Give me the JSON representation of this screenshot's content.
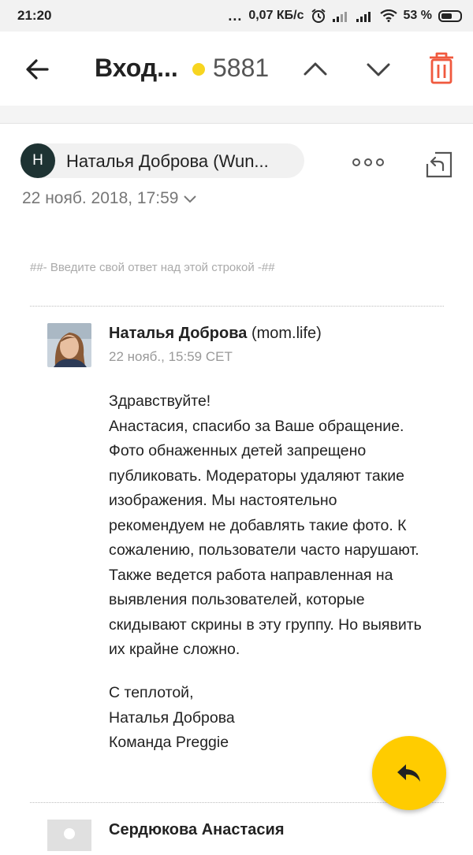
{
  "status_bar": {
    "time": "21:20",
    "dots": "...",
    "speed": "0,07 КБ/с",
    "battery": "53 %"
  },
  "toolbar": {
    "folder_title": "Вход...",
    "unread_count": "5881",
    "unread_dot_color": "#f7d520",
    "trash_color": "#f0593e"
  },
  "message": {
    "sender_initial": "Н",
    "sender_name": "Наталья Доброва (Wun...",
    "date": "22 нояб. 2018, 17:59",
    "quote_marker": "##- Введите свой ответ над этой строкой -##",
    "quoted": {
      "author_name": "Наталья Доброва",
      "author_org": "(mom.life)",
      "meta": "22 нояб., 15:59 CET",
      "body_lines": [
        "Здравствуйте!",
        "Анастасия, спасибо за Ваше обращение.",
        "Фото обнаженных детей запрещено",
        "публиковать. Модераторы удаляют такие",
        "изображения. Мы настоятельно",
        "рекомендуем не добавлять такие фото. К",
        "сожалению, пользователи часто нарушают.",
        "Также ведется работа направленная на",
        "выявления пользователей, которые",
        "скидывают скрины в эту группу. Но выявить",
        "их крайне сложно."
      ],
      "signature_lines": [
        "С теплотой,",
        "Наталья Доброва",
        "Команда Preggie"
      ]
    },
    "next_author": "Сердюкова Анастасия"
  }
}
